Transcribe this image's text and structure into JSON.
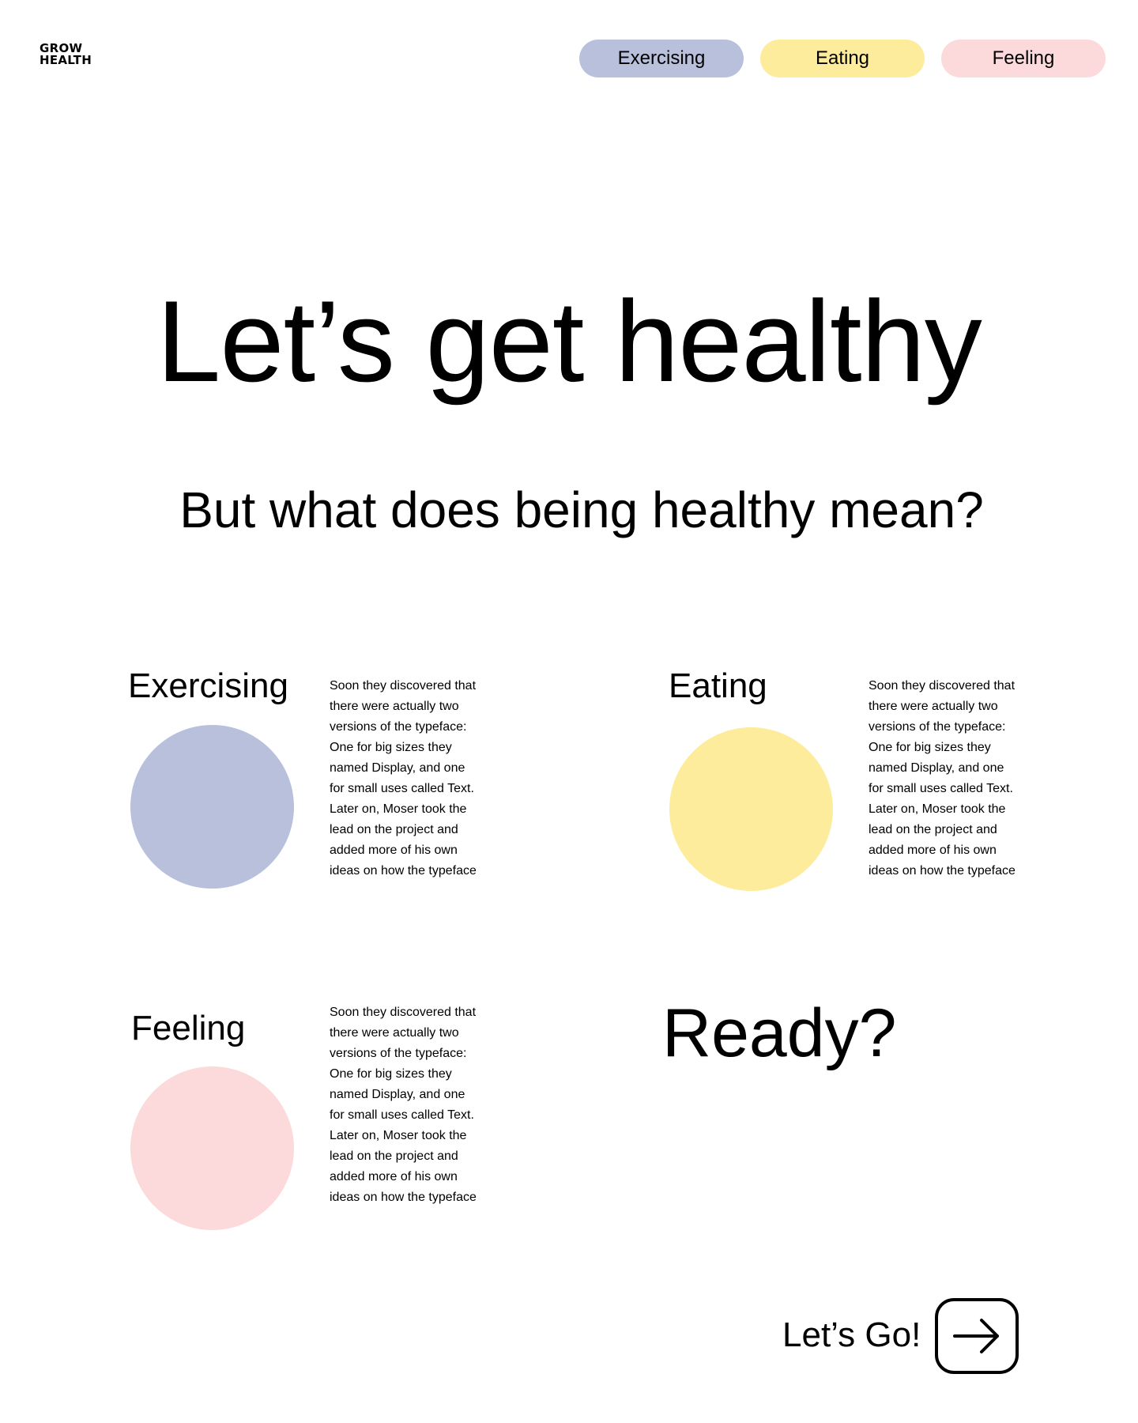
{
  "brand": {
    "logo_line1": "GROW",
    "logo_line2": "HEALTH"
  },
  "colors": {
    "exercising": "#b8c0dc",
    "eating": "#fcec9c",
    "feeling": "#fcdadb"
  },
  "nav": {
    "items": [
      {
        "label": "Exercising"
      },
      {
        "label": "Eating"
      },
      {
        "label": "Feeling"
      }
    ]
  },
  "hero": {
    "title": "Let’s get healthy",
    "subtitle": "But what does being healthy mean?"
  },
  "cards": [
    {
      "title": "Exercising",
      "text": "Soon they discovered that there were actually two versions of the typeface: One for big sizes they named Display, and one for small uses called Text. Later on, Moser took the lead on the project and added more of his own ideas on how the typeface"
    },
    {
      "title": "Eating",
      "text": "Soon they discovered that there were actually two versions of the typeface: One for big sizes they named Display, and one for small uses called Text. Later on, Moser took the lead on the project and added more of his own ideas on how the typeface"
    },
    {
      "title": "Feeling",
      "text": "Soon they discovered that there were actually two versions of the typeface: One for big sizes they named Display, and one for small uses called Text. Later on, Moser took the lead on the project and added more of his own ideas on how the typeface"
    }
  ],
  "cta": {
    "ready": "Ready?",
    "go_label": "Let’s Go!",
    "go_icon": "arrow-right-icon"
  }
}
